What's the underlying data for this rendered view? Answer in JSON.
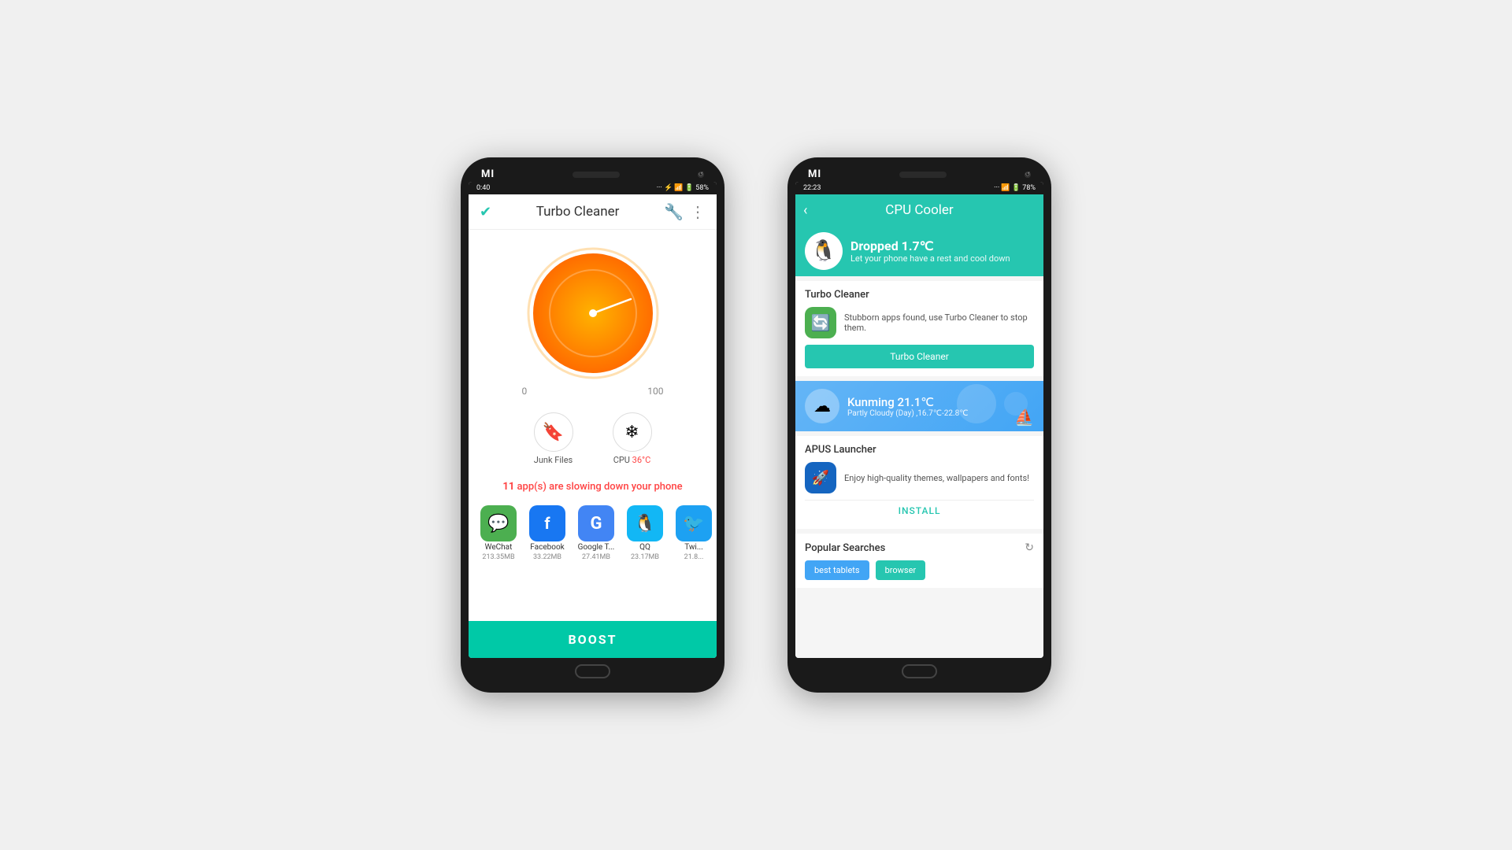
{
  "phone1": {
    "mi_logo": "MI",
    "status_time": "0:40",
    "status_icons": "··· ⚡ 📶 🔋 58%",
    "header": {
      "check_icon": "✔",
      "title": "Turbo Cleaner",
      "more_icon": "⋮"
    },
    "gauge": {
      "min_label": "0",
      "max_label": "100"
    },
    "tools": [
      {
        "icon": "🔖",
        "label": "Junk Files"
      },
      {
        "icon": "❄",
        "label": "CPU 36°C",
        "has_temp": true
      }
    ],
    "slow_apps_text_prefix": "11",
    "slow_apps_text_suffix": " app(s) are slowing down your phone",
    "apps": [
      {
        "name": "WeChat",
        "size": "213.35MB",
        "icon": "💬",
        "color": "#4caf50"
      },
      {
        "name": "Facebook",
        "size": "33.22MB",
        "icon": "f",
        "color": "#1877f2"
      },
      {
        "name": "Google T...",
        "size": "27.41MB",
        "icon": "G",
        "color": "#4285f4"
      },
      {
        "name": "QQ",
        "size": "23.17MB",
        "icon": "🐧",
        "color": "#12b7f5"
      },
      {
        "name": "Twi...",
        "size": "21.8...",
        "icon": "🐦",
        "color": "#1da1f2"
      }
    ],
    "boost_label": "BOOST"
  },
  "phone2": {
    "mi_logo": "MI",
    "status_time": "22:23",
    "status_icons": "··· 📶 🔋 78%",
    "header": {
      "back_icon": "‹",
      "title": "CPU Cooler"
    },
    "dropped_banner": {
      "icon": "🐧",
      "title": "Dropped 1.7℃",
      "subtitle": "Let your phone have a rest and cool down"
    },
    "turbo_section": {
      "title": "Turbo Cleaner",
      "icon": "🔄",
      "description": "Stubborn apps found, use Turbo Cleaner to stop them.",
      "button_label": "Turbo Cleaner"
    },
    "weather_section": {
      "city_temp": "Kunming 21.1℃",
      "description": "Partly Cloudy (Day) ,16.7℃-22.8℃",
      "icon": "☁"
    },
    "apus_section": {
      "title": "APUS Launcher",
      "description": "Enjoy high-quality themes, wallpapers and fonts!",
      "install_label": "INSTALL"
    },
    "popular_section": {
      "title": "Popular Searches",
      "tags": [
        {
          "label": "best tablets",
          "color": "tag-blue"
        },
        {
          "label": "browser",
          "color": "tag-teal"
        }
      ]
    }
  }
}
